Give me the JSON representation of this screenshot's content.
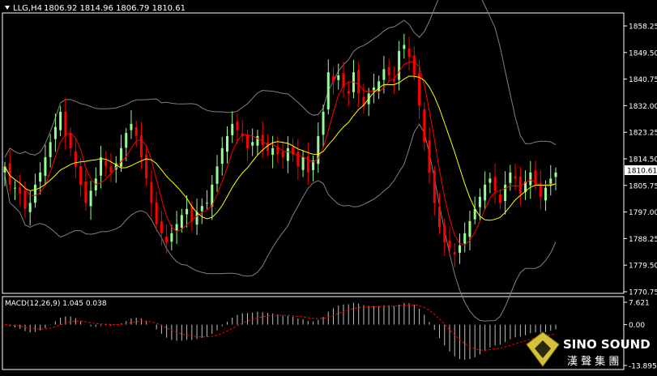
{
  "header": {
    "symbol": "LLG,H4",
    "ohlc": "1806.92 1814.96 1806.79 1810.61"
  },
  "price_axis": {
    "labels": [
      "1858.25",
      "1849.50",
      "1840.75",
      "1832.00",
      "1823.25",
      "1814.50",
      "1805.75",
      "1797.00",
      "1788.25",
      "1779.50",
      "1770.75"
    ],
    "current_price": "1810.61"
  },
  "macd": {
    "label": "MACD(12,26,9) 1.045 0.038",
    "axis_labels": [
      "7.621",
      "0.00",
      "-13.895"
    ]
  },
  "watermark": {
    "brand": "SINO SOUND",
    "chinese": "漢 聲 集 團"
  },
  "colors": {
    "background": "#000000",
    "bull": "#98FB98",
    "bear": "#FF0000",
    "ma_fast": "#FF0000",
    "ma_slow": "#FFFF00",
    "bands": "#808080",
    "macd_hist": "#C0C0C0",
    "macd_signal": "#FF0000",
    "axis_text": "#FFFFFF"
  },
  "chart_data": {
    "type": "candlestick",
    "ylim": [
      1770.75,
      1860
    ],
    "series": [
      {
        "name": "close",
        "values": [
          1812,
          1806,
          1805,
          1803,
          1798,
          1800,
          1806,
          1810,
          1815,
          1820,
          1825,
          1830,
          1822,
          1818,
          1812,
          1806,
          1800,
          1804,
          1808,
          1815,
          1812,
          1810,
          1813,
          1818,
          1823,
          1826,
          1822,
          1815,
          1808,
          1800,
          1793,
          1790,
          1787,
          1790,
          1793,
          1796,
          1798,
          1794,
          1797,
          1799,
          1800,
          1806,
          1812,
          1818,
          1822,
          1826,
          1824,
          1822,
          1818,
          1820,
          1822,
          1819,
          1817,
          1818,
          1816,
          1815,
          1818,
          1816,
          1812,
          1815,
          1810,
          1814,
          1822,
          1830,
          1843,
          1840,
          1842,
          1838,
          1836,
          1843,
          1836,
          1832,
          1836,
          1838,
          1840,
          1844,
          1842,
          1840,
          1850,
          1852,
          1848,
          1842,
          1832,
          1820,
          1810,
          1800,
          1792,
          1787,
          1785,
          1783,
          1786,
          1790,
          1794,
          1798,
          1802,
          1806,
          1808,
          1804,
          1800,
          1806,
          1810,
          1808,
          1803,
          1807,
          1810,
          1806,
          1802,
          1805,
          1808,
          1810
        ]
      }
    ]
  }
}
